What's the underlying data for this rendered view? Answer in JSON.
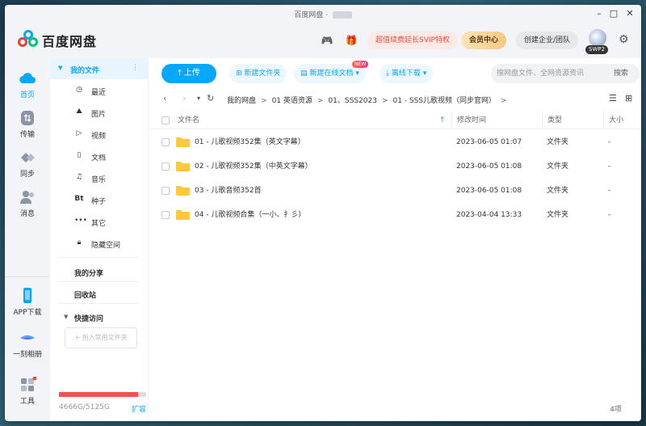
{
  "window": {
    "title": "百度网盘 · "
  },
  "header": {
    "logo_text": "百度网盘",
    "svip_label": "超值续费延长SVIP特权",
    "vip_label": "会员中心",
    "biz_label": "创建企业/团队",
    "avatar_badge": "SWP2"
  },
  "leftnav": {
    "items": [
      {
        "label": "首页",
        "icon": "cloud-home-icon"
      },
      {
        "label": "传输",
        "icon": "transfer-icon"
      },
      {
        "label": "同步",
        "icon": "sync-icon"
      },
      {
        "label": "消息",
        "icon": "message-icon"
      },
      {
        "label": "APP下载",
        "icon": "phone-icon"
      },
      {
        "label": "一刻相册",
        "icon": "album-icon"
      },
      {
        "label": "工具",
        "icon": "tools-icon"
      }
    ]
  },
  "sidebar": {
    "my_files": "我的文件",
    "items": [
      {
        "label": "最近",
        "icon": "clock-icon"
      },
      {
        "label": "图片",
        "icon": "image-icon"
      },
      {
        "label": "视频",
        "icon": "play-icon"
      },
      {
        "label": "文档",
        "icon": "document-icon"
      },
      {
        "label": "音乐",
        "icon": "headphones-icon"
      },
      {
        "label": "种子",
        "icon": "bt-icon"
      },
      {
        "label": "其它",
        "icon": "more-icon"
      },
      {
        "label": "隐藏空间",
        "icon": "lock-icon"
      }
    ],
    "my_share": "我的分享",
    "recycle": "回收站",
    "quick_access": "快捷访问",
    "add_folder": "+ 拖入常用文件夹",
    "storage_text": "4666G/5125G",
    "storage_fraction": 0.91,
    "expand_label": "扩容"
  },
  "toolbar": {
    "upload": "上传",
    "new_folder": "新建文件夹",
    "new_online_doc": "新建在线文档",
    "new_badge": "NEW",
    "offline_download": "离线下载",
    "search_placeholder": "搜网盘文件、全网资源资讯",
    "search_button": "搜索"
  },
  "breadcrumb": [
    "我的网盘",
    "01 英语资源",
    "01、SSS2023",
    "01 - SSS儿歌视频（同步官网）"
  ],
  "table": {
    "headers": {
      "name": "文件名",
      "modified": "修改时间",
      "type": "类型",
      "size": "大小"
    },
    "rows": [
      {
        "name": "01 - 儿歌视频352集（英文字幕）",
        "modified": "2023-06-05 01:07",
        "type": "文件夹",
        "size": "-"
      },
      {
        "name": "02 - 儿歌视频352集（中英文字幕）",
        "modified": "2023-06-05 01:08",
        "type": "文件夹",
        "size": "-"
      },
      {
        "name": "03 - 儿歌音频352首",
        "modified": "2023-06-05 01:08",
        "type": "文件夹",
        "size": "-"
      },
      {
        "name": "04 - 儿歌视频合集（一小、扌彡）",
        "modified": "2023-04-04 13:33",
        "type": "文件夹",
        "size": "-"
      }
    ],
    "count": "4项"
  },
  "colors": {
    "accent": "#06a7ff",
    "svip": "#f5483d",
    "folder": "#ffc83d"
  }
}
